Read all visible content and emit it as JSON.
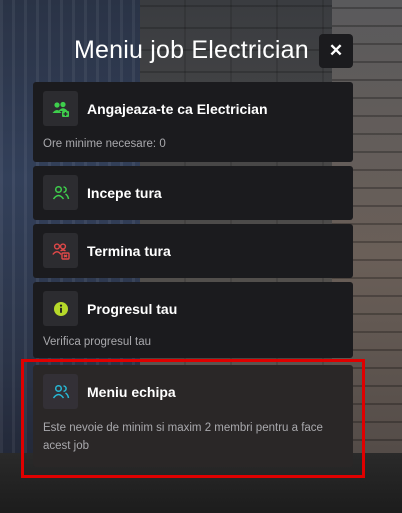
{
  "menu": {
    "title": "Meniu job Electrician",
    "close_label": "✕",
    "items": [
      {
        "title": "Angajeaza-te ca Electrician",
        "subtitle": "Ore minime necesare: 0",
        "icon": "users-add-icon",
        "icon_color": "#3ecf4c"
      },
      {
        "title": "Incepe tura",
        "subtitle": "",
        "icon": "users-icon",
        "icon_color": "#3ecf4c"
      },
      {
        "title": "Termina tura",
        "subtitle": "",
        "icon": "users-remove-icon",
        "icon_color": "#e04848"
      },
      {
        "title": "Progresul tau",
        "subtitle": "Verifica progresul tau",
        "icon": "info-icon",
        "icon_color": "#b6d92a"
      },
      {
        "title": "Meniu echipa",
        "subtitle": "Este nevoie de minim si maxim 2 membri pentru a face acest job",
        "icon": "team-icon",
        "icon_color": "#27b7d4"
      }
    ]
  }
}
